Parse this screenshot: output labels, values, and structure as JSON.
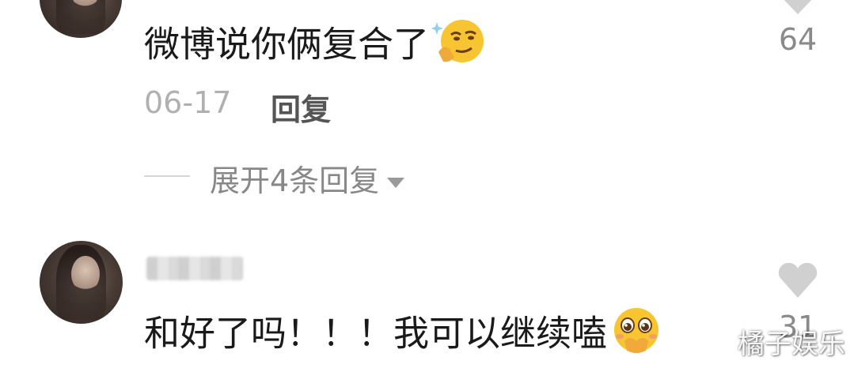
{
  "comments": [
    {
      "text": "微博说你俩复合了",
      "emoji": "smirk-thinking-emoji",
      "date": "06-17",
      "reply_label": "回复",
      "expand_label": "展开4条回复",
      "like_count": "64"
    },
    {
      "text": "和好了吗！！！我可以继续嗑",
      "emoji": "pleading-hands-over-mouth-emoji",
      "like_count": "31"
    }
  ],
  "watermark": "橘子娱乐",
  "colors": {
    "background": "#ffffff",
    "text": "#1a1a1a",
    "muted": "#b0b0b0",
    "heart": "#d0d0d0",
    "emoji_yellow": "#f7c531"
  },
  "icons": [
    "heart-icon",
    "caret-down-icon"
  ]
}
